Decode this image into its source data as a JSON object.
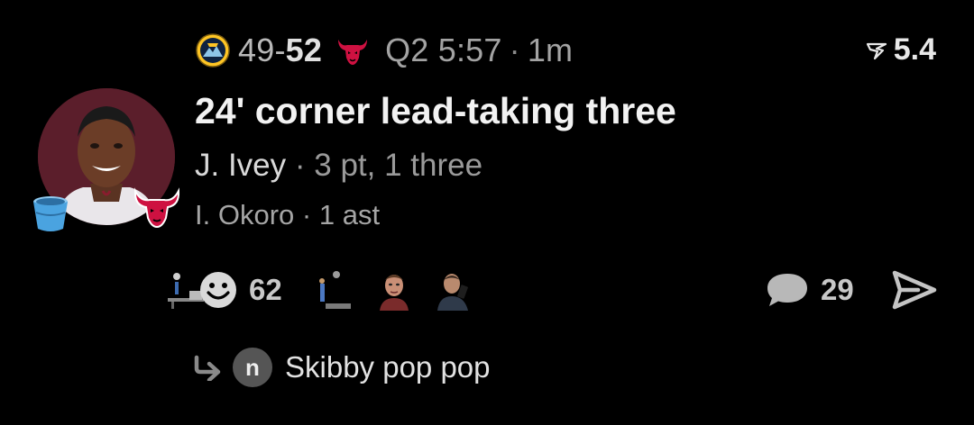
{
  "header": {
    "away_team_icon": "nuggets-logo-icon",
    "away_score": "49",
    "score_separator": "-",
    "home_score": "52",
    "home_team_icon": "bulls-logo-icon",
    "game_clock": "Q2 5:57",
    "separator": "·",
    "posted_ago": "1m",
    "metric_icon": "pennant-icon",
    "metric_value": "5.4"
  },
  "play": {
    "title": "24' corner lead-taking three",
    "scorer_name": "J. Ivey",
    "scorer_separator": "·",
    "scorer_stats": "3 pt, 1 three",
    "assist_name": "I. Okoro",
    "assist_separator": "·",
    "assist_stats": "1 ast"
  },
  "avatar": {
    "player_icon": "player-headshot",
    "badge_left_icon": "bucket-icon",
    "badge_right_icon": "bulls-logo-icon"
  },
  "reactions": {
    "count": "62",
    "add_reaction_icon": "smiley-icon",
    "thumbnails": [
      "basketball-gif-thumbnail",
      "basketball-shot-thumbnail",
      "man-reaction-thumbnail",
      "man-phone-thumbnail"
    ]
  },
  "comments": {
    "icon": "comment-bubble-icon",
    "count": "29"
  },
  "share": {
    "icon": "send-icon"
  },
  "reply": {
    "icon": "reply-arrow-icon",
    "avatar_initial": "n",
    "text": "Skibby pop pop"
  },
  "colors": {
    "background": "#000000",
    "bulls_red": "#ce1141",
    "nuggets_gold": "#fec524",
    "nuggets_navy": "#0e2240",
    "bucket_blue": "#4aa3e0"
  }
}
